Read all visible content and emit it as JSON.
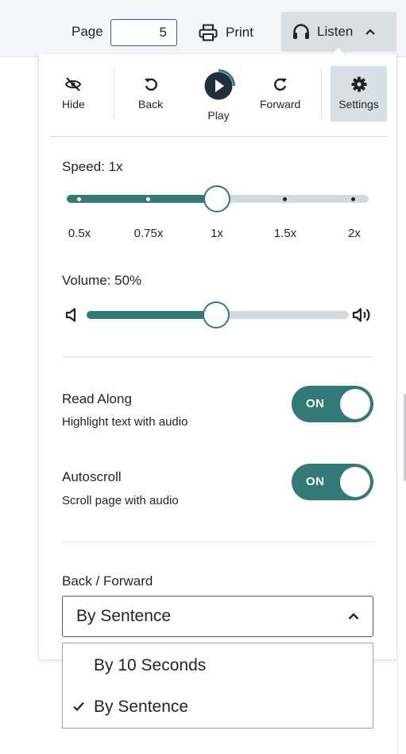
{
  "toolbar": {
    "page_label": "Page",
    "page_value": "5",
    "print_label": "Print",
    "listen_label": "Listen"
  },
  "player": {
    "hide_label": "Hide",
    "back_label": "Back",
    "play_label": "Play",
    "forward_label": "Forward",
    "settings_label": "Settings"
  },
  "speed": {
    "label": "Speed: 1x",
    "value": "1x",
    "ticks": [
      "0.5x",
      "0.75x",
      "1x",
      "1.5x",
      "2x"
    ],
    "selected_index": 2
  },
  "volume": {
    "label": "Volume: 50%",
    "percent": 50
  },
  "read_along": {
    "title": "Read Along",
    "subtitle": "Highlight text with audio",
    "state": "ON"
  },
  "autoscroll": {
    "title": "Autoscroll",
    "subtitle": "Scroll page with audio",
    "state": "ON"
  },
  "back_forward": {
    "label": "Back / Forward",
    "selected": "By Sentence",
    "options": [
      "By 10 Seconds",
      "By Sentence"
    ],
    "selected_option_index": 1
  },
  "colors": {
    "accent": "#317a77",
    "track": "#d4d9df",
    "toolbar_bg": "#f2f5f9",
    "active_button_bg": "#d8dfe6"
  },
  "icons": {
    "print": "printer-icon",
    "listen": "headphones-icon",
    "hide": "eye-slash-icon",
    "back": "rotate-back-icon",
    "play": "play-icon",
    "forward": "rotate-forward-icon",
    "settings": "gear-icon",
    "volume_low": "speaker-low-icon",
    "volume_high": "speaker-high-icon"
  }
}
